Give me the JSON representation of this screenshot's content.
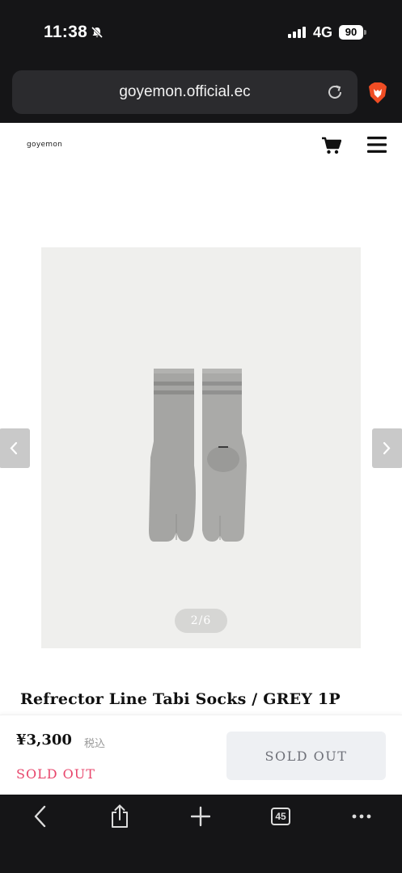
{
  "status_bar": {
    "time": "11:38",
    "network": "4G",
    "battery": "90"
  },
  "browser": {
    "url": "goyemon.official.ec",
    "tab_count": "45"
  },
  "site": {
    "logo_text": "goyemon"
  },
  "gallery": {
    "counter": "2/6",
    "current": 2,
    "total": 6
  },
  "product": {
    "title": "Refrector Line Tabi Socks / GREY 1P",
    "price": "¥3,300",
    "tax_label": "税込",
    "stock_status": "SOLD OUT",
    "button_label": "SOLD OUT"
  },
  "colors": {
    "chrome_dark": "#151517",
    "sold_out_text": "#e8456b",
    "button_bg": "#eef0f3",
    "gallery_bg": "#efefed"
  },
  "icons": [
    "mute-bell-icon",
    "signal-icon",
    "battery-icon",
    "reload-icon",
    "brave-lion-icon",
    "cart-icon",
    "hamburger-menu-icon",
    "chevron-left-icon",
    "chevron-right-icon",
    "back-icon",
    "share-icon",
    "plus-icon",
    "tabs-icon",
    "more-icon"
  ]
}
